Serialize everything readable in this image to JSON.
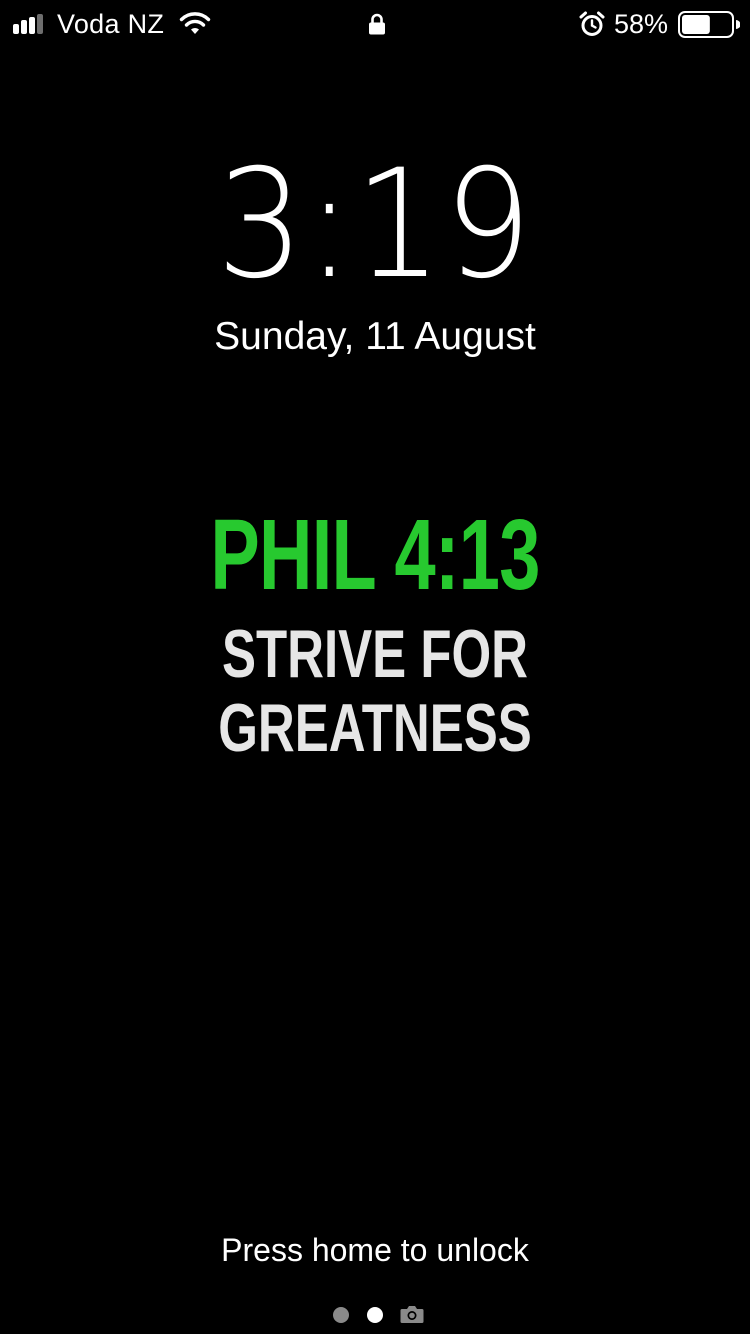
{
  "status_bar": {
    "carrier": "Voda NZ",
    "battery_percent": "58%",
    "battery_level": 0.58,
    "icons": [
      "signal-icon",
      "wifi-icon",
      "lock-icon",
      "alarm-icon",
      "battery-icon"
    ]
  },
  "lock_screen": {
    "time": "3:19",
    "date": "Sunday, 11 August",
    "unlock_hint": "Press home to unlock",
    "page_indicator": {
      "pages": 2,
      "current": 2,
      "trailing_icon": "camera-icon"
    }
  },
  "wallpaper": {
    "verse": "PHIL 4:13",
    "motto": "STRIVE FOR GREATNESS",
    "colors": {
      "verse": "#27c92f",
      "motto": "#e6e6e6",
      "background": "#000000"
    }
  }
}
